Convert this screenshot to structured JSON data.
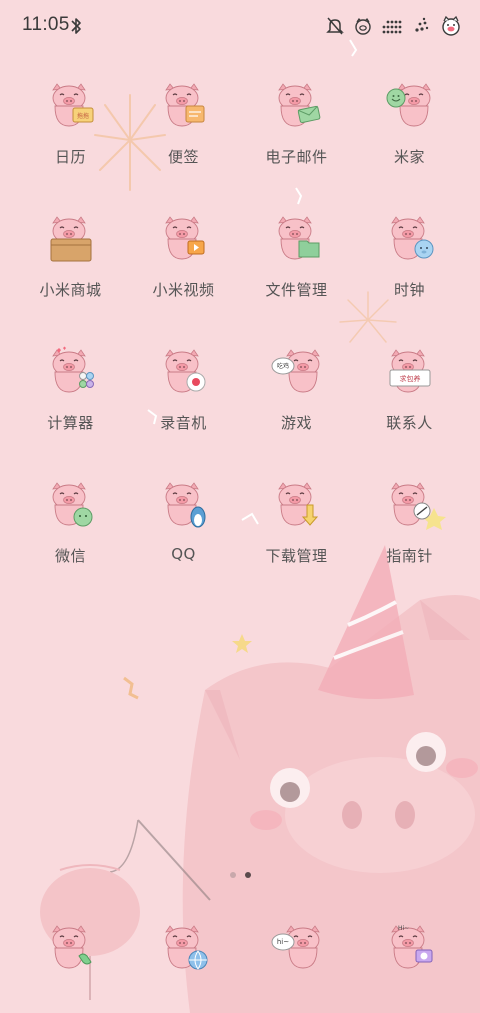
{
  "status_bar": {
    "time": "11:05"
  },
  "home": {
    "apps": [
      {
        "label": "日历",
        "icon": "calendar-pig-icon"
      },
      {
        "label": "便签",
        "icon": "notes-pig-icon"
      },
      {
        "label": "电子邮件",
        "icon": "email-pig-icon"
      },
      {
        "label": "米家",
        "icon": "mijia-pig-icon"
      },
      {
        "label": "小米商城",
        "icon": "mi-store-pig-icon"
      },
      {
        "label": "小米视频",
        "icon": "mi-video-pig-icon"
      },
      {
        "label": "文件管理",
        "icon": "file-manager-pig-icon"
      },
      {
        "label": "时钟",
        "icon": "clock-pig-icon"
      },
      {
        "label": "计算器",
        "icon": "calculator-pig-icon"
      },
      {
        "label": "录音机",
        "icon": "recorder-pig-icon"
      },
      {
        "label": "游戏",
        "icon": "games-pig-icon"
      },
      {
        "label": "联系人",
        "icon": "contacts-pig-icon"
      },
      {
        "label": "微信",
        "icon": "wechat-pig-icon"
      },
      {
        "label": "QQ",
        "icon": "qq-pig-icon"
      },
      {
        "label": "下载管理",
        "icon": "downloads-pig-icon"
      },
      {
        "label": "指南针",
        "icon": "compass-pig-icon"
      }
    ],
    "icon_texts": {
      "calendar": "拖拖",
      "games": "吃鸡",
      "contacts": "求包养",
      "messages": "hi~",
      "camera": "Hi~"
    },
    "pages": 2,
    "current_page": 2
  },
  "dock": {
    "apps": [
      {
        "icon": "phone-pig-icon"
      },
      {
        "icon": "browser-pig-icon"
      },
      {
        "icon": "messages-pig-icon"
      },
      {
        "icon": "camera-pig-icon"
      }
    ]
  },
  "theme": {
    "background": "#f9dadd",
    "pig_pink": "#f6b7bf",
    "text": "#555555"
  }
}
